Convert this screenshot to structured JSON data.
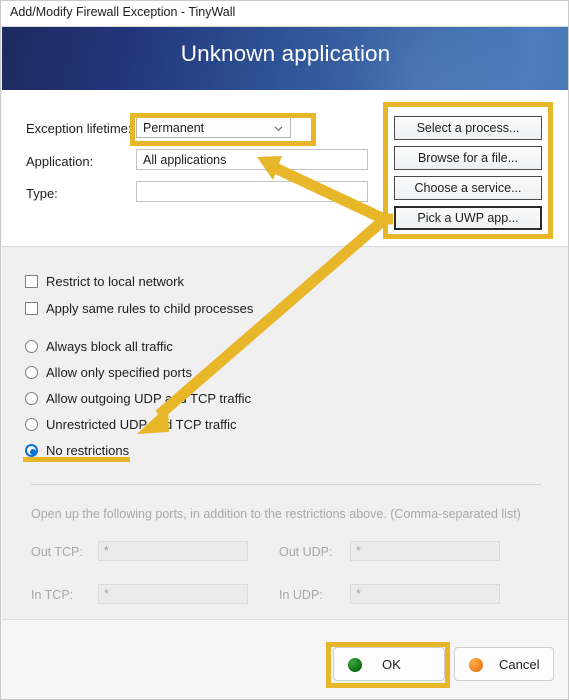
{
  "window": {
    "title": "Add/Modify Firewall Exception - TinyWall"
  },
  "banner": {
    "title": "Unknown application",
    "gradient_start": "#1c2b60",
    "gradient_end": "#4a79b9"
  },
  "form": {
    "lifetime_label": "Exception lifetime:",
    "lifetime_value": "Permanent",
    "application_label": "Application:",
    "application_value": "All applications",
    "type_label": "Type:",
    "type_value": ""
  },
  "side_buttons": [
    {
      "label": "Select a process...",
      "focused": false
    },
    {
      "label": "Browse for a file...",
      "focused": false
    },
    {
      "label": "Choose a service...",
      "focused": false
    },
    {
      "label": "Pick a UWP app...",
      "focused": true
    }
  ],
  "checkboxes": [
    {
      "label": "Restrict to local network",
      "checked": false
    },
    {
      "label": "Apply same rules to child processes",
      "checked": false
    }
  ],
  "radios": [
    {
      "label": "Always block all traffic",
      "selected": false
    },
    {
      "label": "Allow only specified ports",
      "selected": false
    },
    {
      "label": "Allow outgoing UDP and TCP traffic",
      "selected": false
    },
    {
      "label": "Unrestricted UDP and TCP traffic",
      "selected": false
    },
    {
      "label": "No restrictions",
      "selected": true
    }
  ],
  "ports": {
    "note": "Open up the following ports, in addition to the restrictions above. (Comma-separated list)",
    "out_tcp_label": "Out TCP:",
    "out_tcp_value": "*",
    "out_udp_label": "Out UDP:",
    "out_udp_value": "*",
    "in_tcp_label": "In TCP:",
    "in_tcp_value": "*",
    "in_udp_label": "In UDP:",
    "in_udp_value": "*"
  },
  "footer": {
    "ok_label": "OK",
    "ok_icon": "green-circle-icon",
    "cancel_label": "Cancel",
    "cancel_icon": "orange-circle-icon"
  },
  "annotations": {
    "color": "#e8b629",
    "highlight_lifetime": "exception-lifetime-dropdown",
    "highlight_side_buttons": "source-picker-buttons",
    "highlight_ok": "ok-button",
    "underline_no_restrictions": "no-restrictions-radio"
  }
}
